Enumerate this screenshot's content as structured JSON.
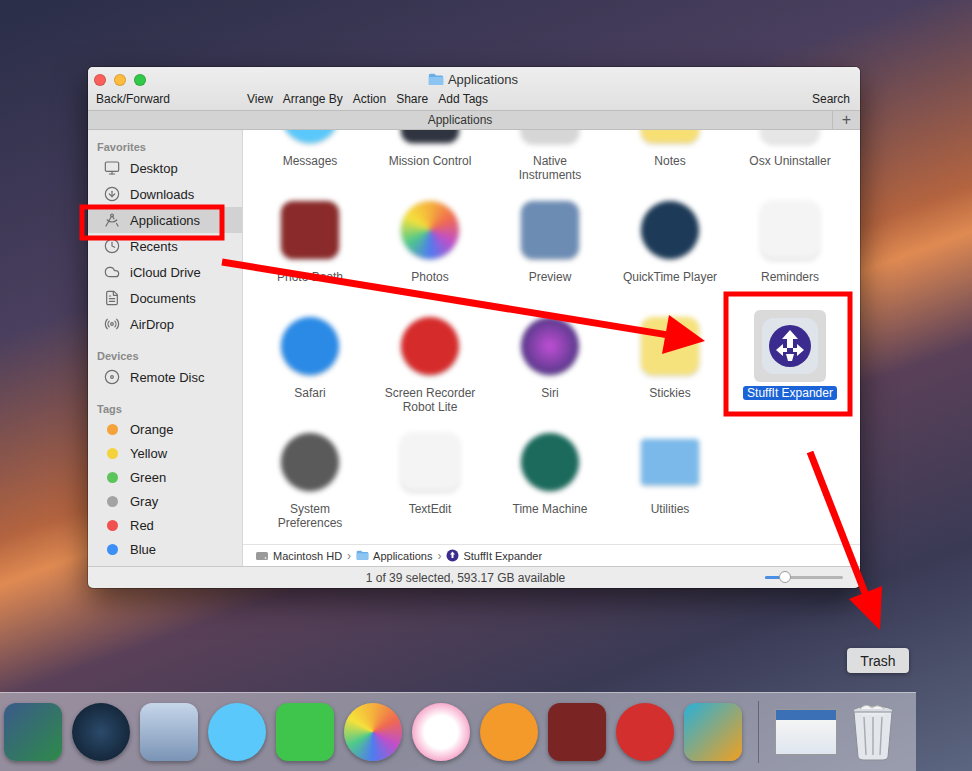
{
  "window": {
    "title": "Applications"
  },
  "toolbar": {
    "left": "Back/Forward",
    "items": [
      "View",
      "Arrange By",
      "Action",
      "Share",
      "Add Tags"
    ],
    "search": "Search"
  },
  "tab_bar": {
    "tabs": [
      {
        "label": "Applications",
        "selected": true
      }
    ],
    "add_button": "+"
  },
  "sidebar": {
    "sections": [
      {
        "heading": "Favorites",
        "kind": "places",
        "items": [
          {
            "label": "Desktop",
            "selected": false
          },
          {
            "label": "Downloads",
            "selected": false
          },
          {
            "label": "Applications",
            "selected": true
          },
          {
            "label": "Recents",
            "selected": false
          },
          {
            "label": "iCloud Drive",
            "selected": false
          },
          {
            "label": "Documents",
            "selected": false
          },
          {
            "label": "AirDrop",
            "selected": false
          }
        ]
      },
      {
        "heading": "Devices",
        "kind": "places",
        "items": [
          {
            "label": "Remote Disc",
            "selected": false
          }
        ]
      },
      {
        "heading": "Tags",
        "kind": "tags",
        "items": [
          {
            "label": "Orange",
            "selected": false,
            "color": "#f5a23b"
          },
          {
            "label": "Yellow",
            "selected": false,
            "color": "#f4d23c"
          },
          {
            "label": "Green",
            "selected": false,
            "color": "#5cc45a"
          },
          {
            "label": "Gray",
            "selected": false,
            "color": "#a3a3a3"
          },
          {
            "label": "Red",
            "selected": false,
            "color": "#f0514e"
          },
          {
            "label": "Blue",
            "selected": false,
            "color": "#3b8ff5"
          }
        ]
      }
    ]
  },
  "apps": [
    {
      "label": "Messages",
      "selected": false
    },
    {
      "label": "Mission Control",
      "selected": false
    },
    {
      "label": "Native Instruments",
      "selected": false
    },
    {
      "label": "Notes",
      "selected": false
    },
    {
      "label": "Osx Uninstaller",
      "selected": false
    },
    {
      "label": "Photo Booth",
      "selected": false
    },
    {
      "label": "Photos",
      "selected": false
    },
    {
      "label": "Preview",
      "selected": false
    },
    {
      "label": "QuickTime Player",
      "selected": false
    },
    {
      "label": "Reminders",
      "selected": false
    },
    {
      "label": "Safari",
      "selected": false
    },
    {
      "label": "Screen Recorder Robot Lite",
      "selected": false
    },
    {
      "label": "Siri",
      "selected": false
    },
    {
      "label": "Stickies",
      "selected": false
    },
    {
      "label": "StuffIt Expander",
      "selected": true
    },
    {
      "label": "System Preferences",
      "selected": false
    },
    {
      "label": "TextEdit",
      "selected": false
    },
    {
      "label": "Time Machine",
      "selected": false
    },
    {
      "label": "Utilities",
      "selected": false
    }
  ],
  "path_bar": {
    "items": [
      "Macintosh HD",
      "Applications",
      "StuffIt Expander"
    ],
    "separator": "›"
  },
  "status_bar": {
    "text": "1 of 39 selected, 593.17 GB available",
    "zoom": {
      "level": 0.26
    }
  },
  "dock": {
    "tooltip": "Trash"
  }
}
